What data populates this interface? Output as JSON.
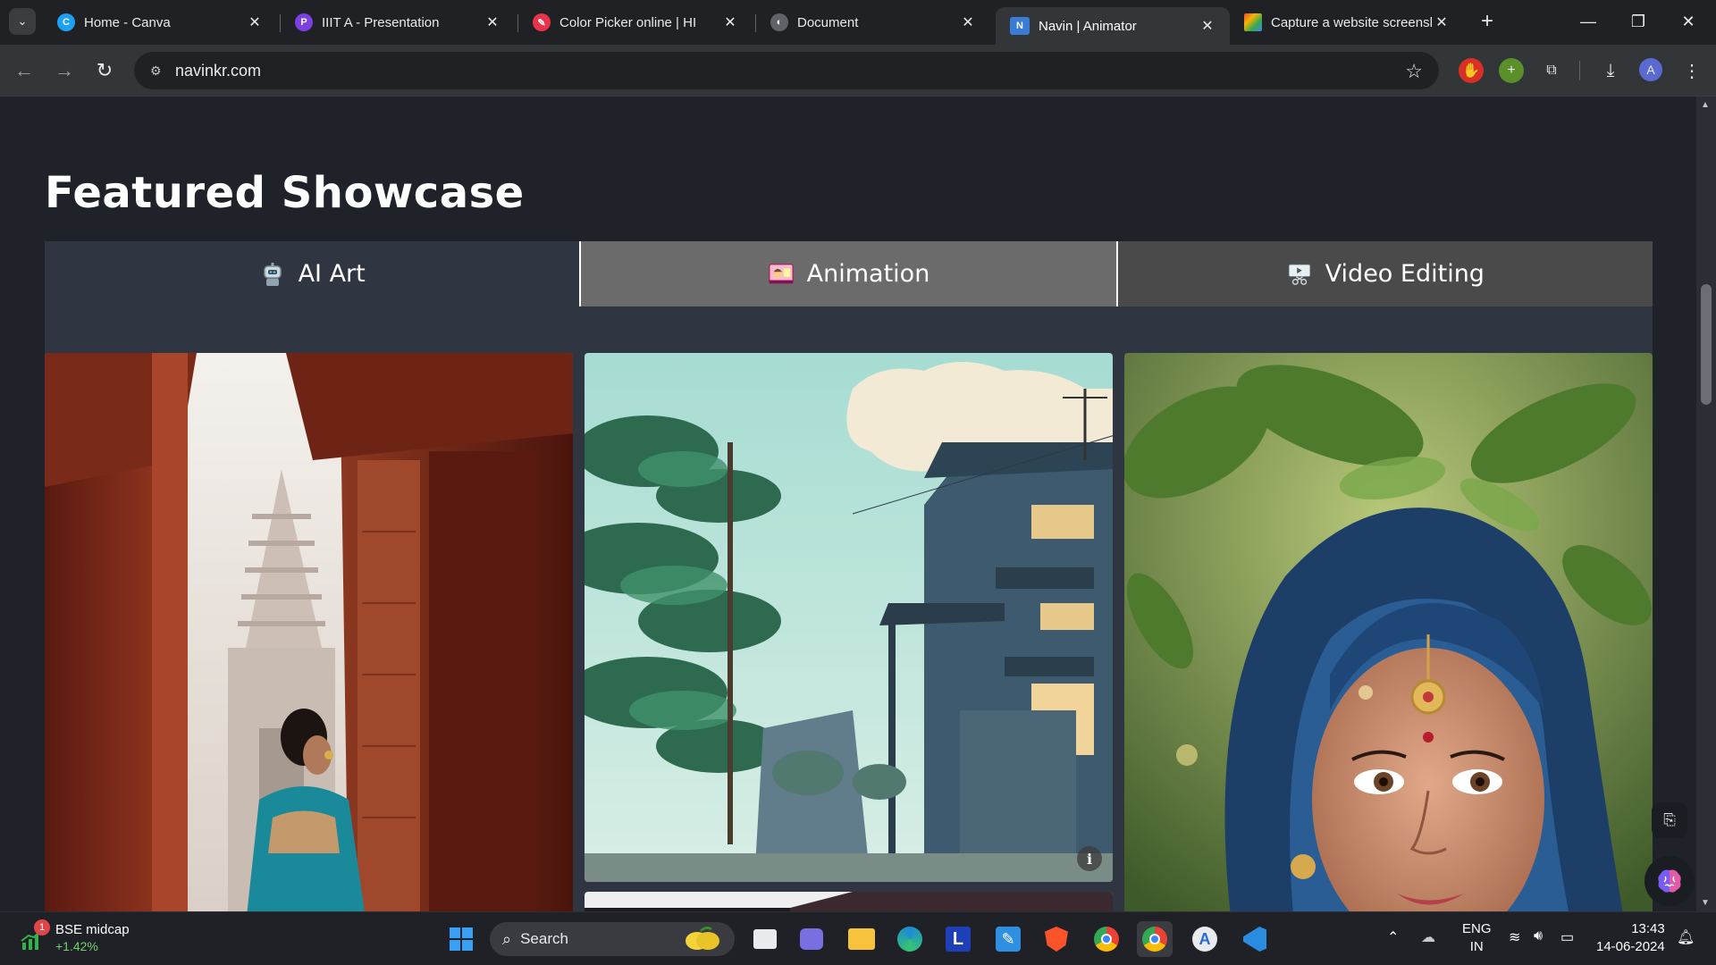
{
  "browser": {
    "tabs": [
      {
        "title": "Home - Canva",
        "favicon": "canva-icon",
        "color": "#1da1f2"
      },
      {
        "title": "IIIT A - Presentation",
        "favicon": "presentation-icon",
        "color": "#7b3fe4"
      },
      {
        "title": "Color Picker online | HI",
        "favicon": "color-picker-icon",
        "color": "#e8334a"
      },
      {
        "title": "Document",
        "favicon": "document-icon",
        "color": "#5f6368"
      },
      {
        "title": "Navin | Animator",
        "favicon": "navin-logo-icon",
        "color": "#3a7bd5"
      },
      {
        "title": "Capture a website screensh",
        "favicon": "screenshot-tool-icon",
        "color": "#e94b3c"
      }
    ],
    "active_tab_index": 4,
    "url": "navinkr.com"
  },
  "page": {
    "showcase_title": "Featured Showcase",
    "tabs": [
      {
        "label": "AI Art",
        "icon": "robot-icon"
      },
      {
        "label": "Animation",
        "icon": "animation-icon"
      },
      {
        "label": "Video Editing",
        "icon": "video-editing-icon"
      }
    ],
    "active_tab": "AI Art",
    "cards": [
      {
        "subject": "temple-courtyard-art",
        "icon": "image"
      },
      {
        "subject": "anime-street-art",
        "icon": "image"
      },
      {
        "subject": "blue-haired-portrait-art",
        "icon": "image"
      }
    ],
    "info_icon": "i"
  },
  "taskbar": {
    "widget": {
      "title": "BSE midcap",
      "change": "+1.42%",
      "badge": "1"
    },
    "search_label": "Search",
    "language": {
      "line1": "ENG",
      "line2": "IN"
    },
    "time": "13:43",
    "date": "14-06-2024"
  },
  "colors": {
    "page_bg": "#1f2329",
    "panel_bg": "#2f3541",
    "active_tab_bg": "#2f3541",
    "animation_tab_bg": "#6b6b6b",
    "video_tab_bg": "#4a4a4a"
  }
}
